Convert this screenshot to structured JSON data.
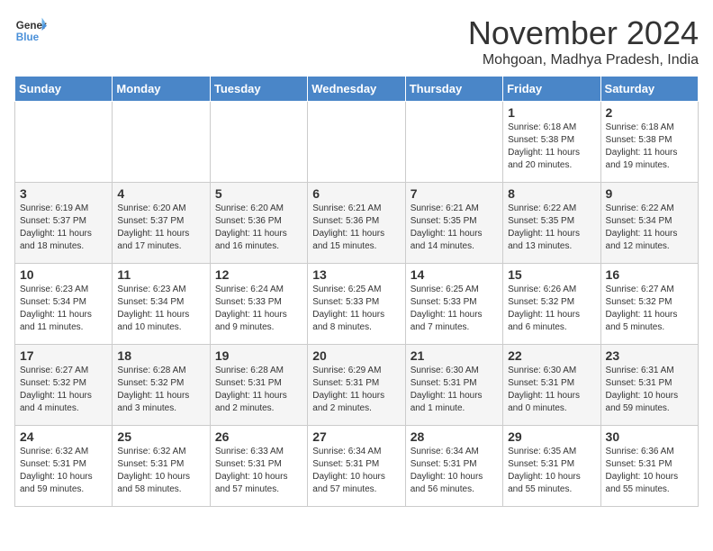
{
  "logo": {
    "line1": "General",
    "line2": "Blue"
  },
  "title": "November 2024",
  "location": "Mohgoan, Madhya Pradesh, India",
  "headers": [
    "Sunday",
    "Monday",
    "Tuesday",
    "Wednesday",
    "Thursday",
    "Friday",
    "Saturday"
  ],
  "weeks": [
    [
      {
        "day": "",
        "sunrise": "",
        "sunset": "",
        "daylight": ""
      },
      {
        "day": "",
        "sunrise": "",
        "sunset": "",
        "daylight": ""
      },
      {
        "day": "",
        "sunrise": "",
        "sunset": "",
        "daylight": ""
      },
      {
        "day": "",
        "sunrise": "",
        "sunset": "",
        "daylight": ""
      },
      {
        "day": "",
        "sunrise": "",
        "sunset": "",
        "daylight": ""
      },
      {
        "day": "1",
        "sunrise": "Sunrise: 6:18 AM",
        "sunset": "Sunset: 5:38 PM",
        "daylight": "Daylight: 11 hours and 20 minutes."
      },
      {
        "day": "2",
        "sunrise": "Sunrise: 6:18 AM",
        "sunset": "Sunset: 5:38 PM",
        "daylight": "Daylight: 11 hours and 19 minutes."
      }
    ],
    [
      {
        "day": "3",
        "sunrise": "Sunrise: 6:19 AM",
        "sunset": "Sunset: 5:37 PM",
        "daylight": "Daylight: 11 hours and 18 minutes."
      },
      {
        "day": "4",
        "sunrise": "Sunrise: 6:20 AM",
        "sunset": "Sunset: 5:37 PM",
        "daylight": "Daylight: 11 hours and 17 minutes."
      },
      {
        "day": "5",
        "sunrise": "Sunrise: 6:20 AM",
        "sunset": "Sunset: 5:36 PM",
        "daylight": "Daylight: 11 hours and 16 minutes."
      },
      {
        "day": "6",
        "sunrise": "Sunrise: 6:21 AM",
        "sunset": "Sunset: 5:36 PM",
        "daylight": "Daylight: 11 hours and 15 minutes."
      },
      {
        "day": "7",
        "sunrise": "Sunrise: 6:21 AM",
        "sunset": "Sunset: 5:35 PM",
        "daylight": "Daylight: 11 hours and 14 minutes."
      },
      {
        "day": "8",
        "sunrise": "Sunrise: 6:22 AM",
        "sunset": "Sunset: 5:35 PM",
        "daylight": "Daylight: 11 hours and 13 minutes."
      },
      {
        "day": "9",
        "sunrise": "Sunrise: 6:22 AM",
        "sunset": "Sunset: 5:34 PM",
        "daylight": "Daylight: 11 hours and 12 minutes."
      }
    ],
    [
      {
        "day": "10",
        "sunrise": "Sunrise: 6:23 AM",
        "sunset": "Sunset: 5:34 PM",
        "daylight": "Daylight: 11 hours and 11 minutes."
      },
      {
        "day": "11",
        "sunrise": "Sunrise: 6:23 AM",
        "sunset": "Sunset: 5:34 PM",
        "daylight": "Daylight: 11 hours and 10 minutes."
      },
      {
        "day": "12",
        "sunrise": "Sunrise: 6:24 AM",
        "sunset": "Sunset: 5:33 PM",
        "daylight": "Daylight: 11 hours and 9 minutes."
      },
      {
        "day": "13",
        "sunrise": "Sunrise: 6:25 AM",
        "sunset": "Sunset: 5:33 PM",
        "daylight": "Daylight: 11 hours and 8 minutes."
      },
      {
        "day": "14",
        "sunrise": "Sunrise: 6:25 AM",
        "sunset": "Sunset: 5:33 PM",
        "daylight": "Daylight: 11 hours and 7 minutes."
      },
      {
        "day": "15",
        "sunrise": "Sunrise: 6:26 AM",
        "sunset": "Sunset: 5:32 PM",
        "daylight": "Daylight: 11 hours and 6 minutes."
      },
      {
        "day": "16",
        "sunrise": "Sunrise: 6:27 AM",
        "sunset": "Sunset: 5:32 PM",
        "daylight": "Daylight: 11 hours and 5 minutes."
      }
    ],
    [
      {
        "day": "17",
        "sunrise": "Sunrise: 6:27 AM",
        "sunset": "Sunset: 5:32 PM",
        "daylight": "Daylight: 11 hours and 4 minutes."
      },
      {
        "day": "18",
        "sunrise": "Sunrise: 6:28 AM",
        "sunset": "Sunset: 5:32 PM",
        "daylight": "Daylight: 11 hours and 3 minutes."
      },
      {
        "day": "19",
        "sunrise": "Sunrise: 6:28 AM",
        "sunset": "Sunset: 5:31 PM",
        "daylight": "Daylight: 11 hours and 2 minutes."
      },
      {
        "day": "20",
        "sunrise": "Sunrise: 6:29 AM",
        "sunset": "Sunset: 5:31 PM",
        "daylight": "Daylight: 11 hours and 2 minutes."
      },
      {
        "day": "21",
        "sunrise": "Sunrise: 6:30 AM",
        "sunset": "Sunset: 5:31 PM",
        "daylight": "Daylight: 11 hours and 1 minute."
      },
      {
        "day": "22",
        "sunrise": "Sunrise: 6:30 AM",
        "sunset": "Sunset: 5:31 PM",
        "daylight": "Daylight: 11 hours and 0 minutes."
      },
      {
        "day": "23",
        "sunrise": "Sunrise: 6:31 AM",
        "sunset": "Sunset: 5:31 PM",
        "daylight": "Daylight: 10 hours and 59 minutes."
      }
    ],
    [
      {
        "day": "24",
        "sunrise": "Sunrise: 6:32 AM",
        "sunset": "Sunset: 5:31 PM",
        "daylight": "Daylight: 10 hours and 59 minutes."
      },
      {
        "day": "25",
        "sunrise": "Sunrise: 6:32 AM",
        "sunset": "Sunset: 5:31 PM",
        "daylight": "Daylight: 10 hours and 58 minutes."
      },
      {
        "day": "26",
        "sunrise": "Sunrise: 6:33 AM",
        "sunset": "Sunset: 5:31 PM",
        "daylight": "Daylight: 10 hours and 57 minutes."
      },
      {
        "day": "27",
        "sunrise": "Sunrise: 6:34 AM",
        "sunset": "Sunset: 5:31 PM",
        "daylight": "Daylight: 10 hours and 57 minutes."
      },
      {
        "day": "28",
        "sunrise": "Sunrise: 6:34 AM",
        "sunset": "Sunset: 5:31 PM",
        "daylight": "Daylight: 10 hours and 56 minutes."
      },
      {
        "day": "29",
        "sunrise": "Sunrise: 6:35 AM",
        "sunset": "Sunset: 5:31 PM",
        "daylight": "Daylight: 10 hours and 55 minutes."
      },
      {
        "day": "30",
        "sunrise": "Sunrise: 6:36 AM",
        "sunset": "Sunset: 5:31 PM",
        "daylight": "Daylight: 10 hours and 55 minutes."
      }
    ]
  ]
}
